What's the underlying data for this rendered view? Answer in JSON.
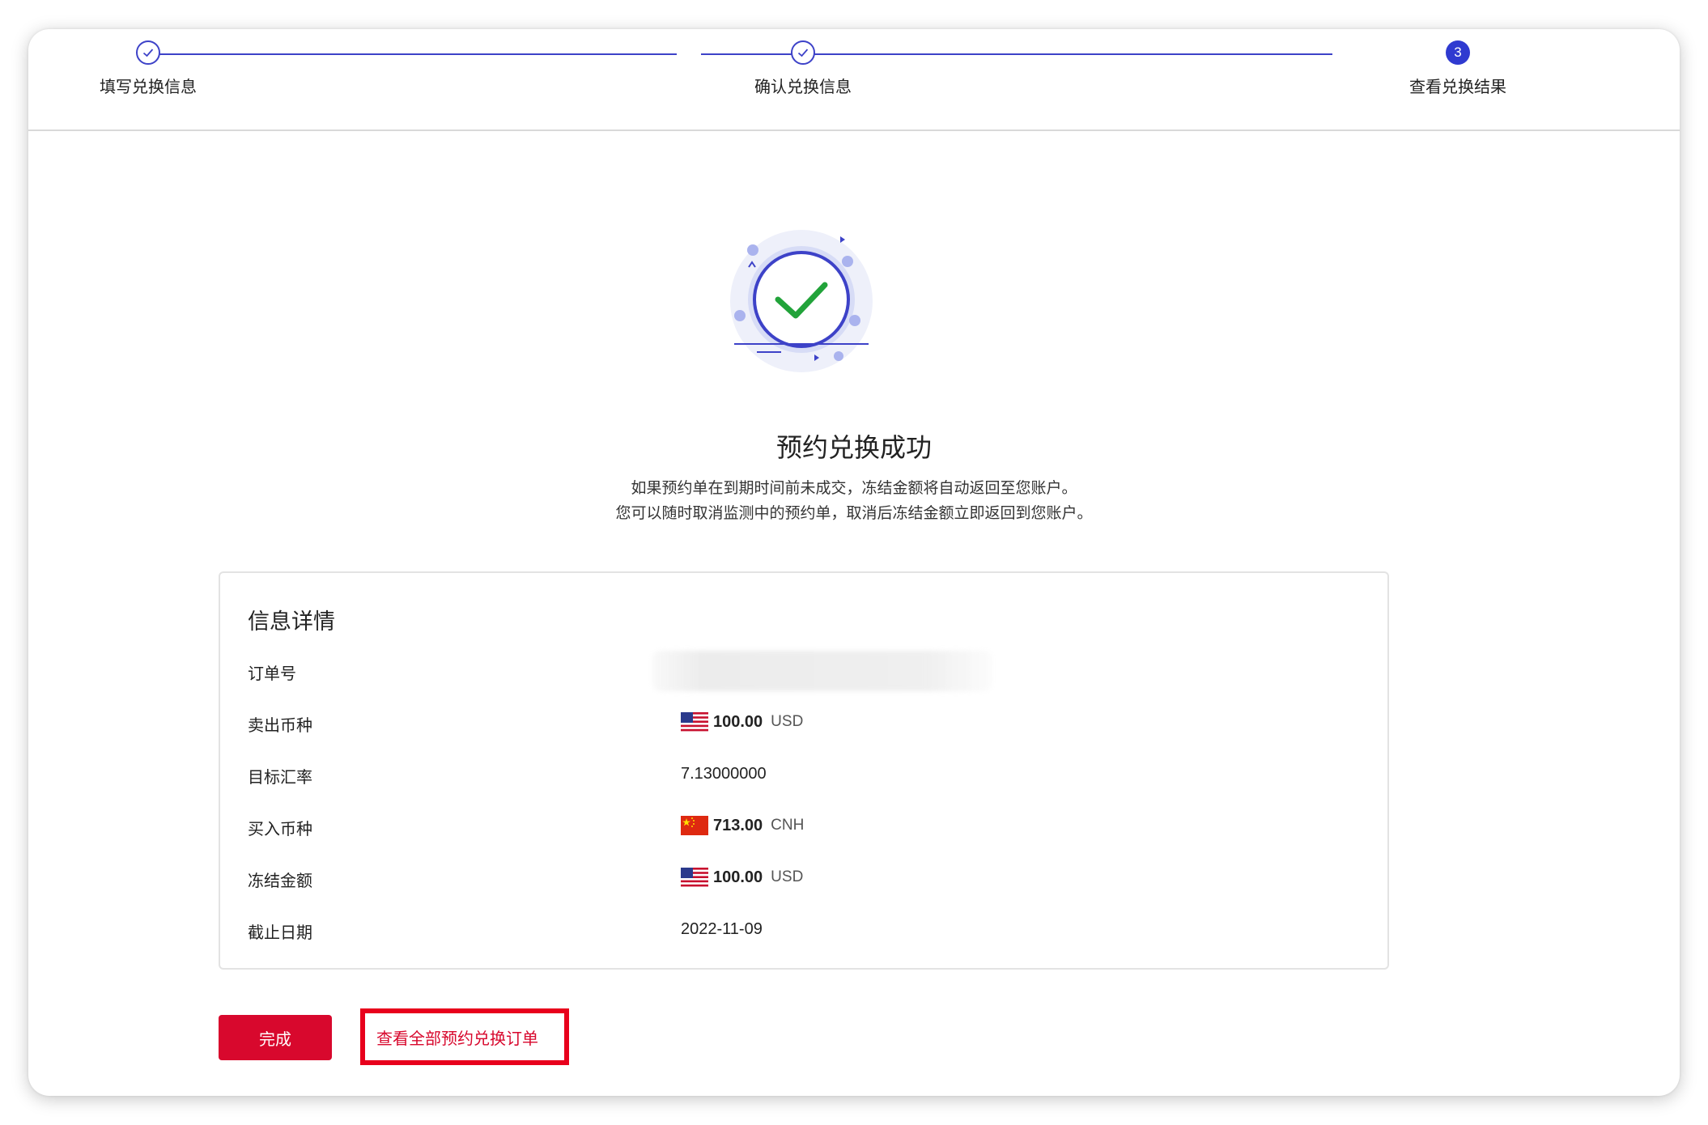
{
  "stepper": {
    "steps": [
      {
        "label": "填写兑换信息",
        "status": "done"
      },
      {
        "label": "确认兑换信息",
        "status": "done"
      },
      {
        "label": "查看兑换结果",
        "status": "current",
        "number": "3"
      }
    ]
  },
  "result": {
    "title": "预约兑换成功",
    "desc_line1": "如果预约单在到期时间前未成交，冻结金额将自动返回至您账户。",
    "desc_line2": "您可以随时取消监测中的预约单，取消后冻结金额立即返回到您账户。"
  },
  "info": {
    "title": "信息详情",
    "order_no": {
      "label": "订单号",
      "value": ""
    },
    "sell": {
      "label": "卖出币种",
      "amount": "100.00",
      "currency": "USD",
      "flag": "us-flag-icon"
    },
    "rate": {
      "label": "目标汇率",
      "value": "7.13000000"
    },
    "buy": {
      "label": "买入币种",
      "amount": "713.00",
      "currency": "CNH",
      "flag": "cn-flag-icon"
    },
    "frozen": {
      "label": "冻结金额",
      "amount": "100.00",
      "currency": "USD",
      "flag": "us-flag-icon"
    },
    "deadline": {
      "label": "截止日期",
      "value": "2022-11-09"
    }
  },
  "actions": {
    "done_label": "完成",
    "view_all_label": "查看全部预约兑换订单"
  },
  "colors": {
    "primary": "#3d42c8",
    "accent_red": "#d8082d",
    "success_green": "#22a33a"
  }
}
